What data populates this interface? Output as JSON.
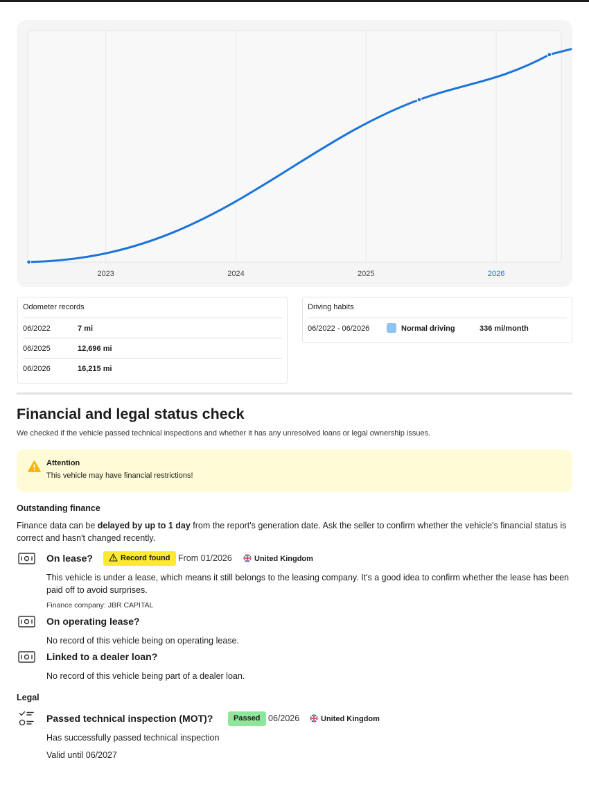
{
  "odometer_chart": {
    "type": "line",
    "x_ticks": [
      "2023",
      "2024",
      "2025",
      "2026"
    ],
    "highlight_tick": "2026",
    "points": [
      {
        "date": "06/2022",
        "mileage_mi": 7
      },
      {
        "date": "06/2025",
        "mileage_mi": 12696
      },
      {
        "date": "06/2026",
        "mileage_mi": 16215
      }
    ],
    "line_color": "#1a73d9",
    "highlight_color": "#1a6fc9"
  },
  "odometer_records": {
    "title": "Odometer records",
    "rows": [
      {
        "date": "06/2022",
        "mileage": "7 mi"
      },
      {
        "date": "06/2025",
        "mileage": "12,696 mi"
      },
      {
        "date": "06/2026",
        "mileage": "16,215 mi"
      }
    ]
  },
  "driving_habits": {
    "title": "Driving habits",
    "period": "06/2022 - 06/2026",
    "label": "Normal driving",
    "rate": "336 mi/month",
    "swatch_color": "#8fc3f3"
  },
  "financial": {
    "title": "Financial and legal status check",
    "subtitle": "We checked if the vehicle passed technical inspections and whether it has any unresolved loans or legal ownership issues.",
    "attention": {
      "title": "Attention",
      "text": "This vehicle may have financial restrictions!",
      "icon": "warning-icon",
      "color": "#f5b400"
    },
    "outstanding": {
      "heading": "Outstanding finance",
      "note_pre": "Finance data can be ",
      "note_bold": "delayed by up to 1 day",
      "note_post": " from the report's generation date. Ask the seller to confirm whether the vehicle's financial status is correct and hasn't changed recently."
    },
    "on_lease": {
      "title": "On lease?",
      "badge": "Record found",
      "badge_color": "#fde92d",
      "date": "From 01/2026",
      "country": "United Kingdom",
      "text": "This vehicle is under a lease, which means it still belongs to the leasing company. It's a good idea to confirm whether the lease has been paid off to avoid surprises.",
      "company": "Finance company: JBR CAPITAL"
    },
    "operating_lease": {
      "title": "On operating lease?",
      "text": "No record of this vehicle being on operating lease."
    },
    "dealer_loan": {
      "title": "Linked to a dealer loan?",
      "text": "No record of this vehicle being part of a dealer loan."
    }
  },
  "legal": {
    "heading": "Legal",
    "mot": {
      "title": "Passed technical inspection (MOT)?",
      "badge": "Passed",
      "badge_color": "#8fe59b",
      "date": "06/2026",
      "country": "United Kingdom",
      "text": "Has successfully passed technical inspection",
      "valid": "Valid until 06/2027"
    }
  }
}
